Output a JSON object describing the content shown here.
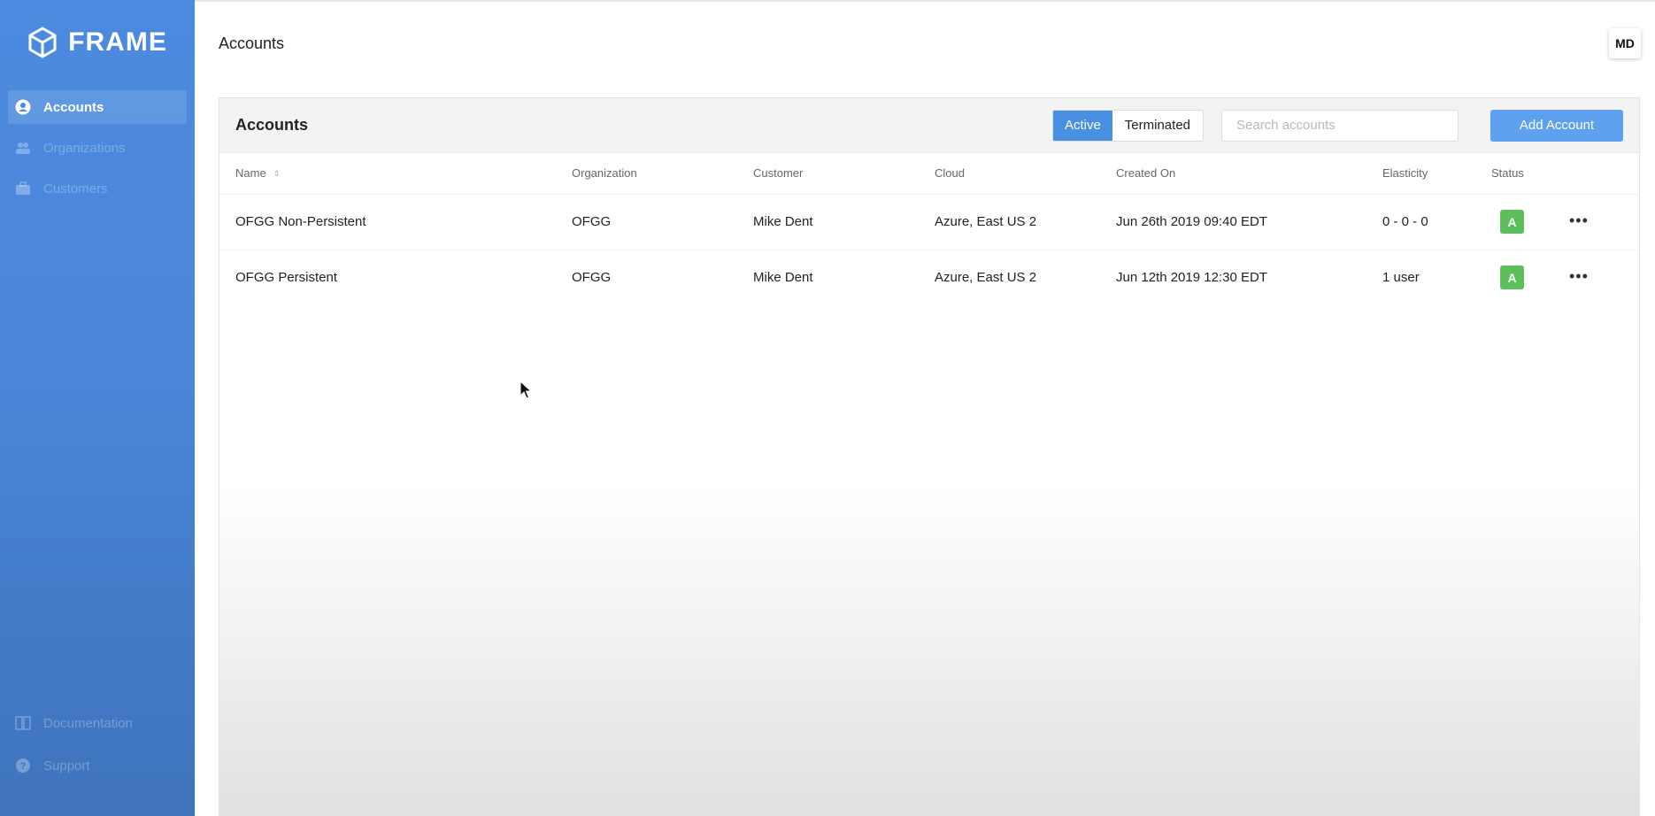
{
  "brand": {
    "name": "FRAME",
    "icon": "cube-icon"
  },
  "sidebar": {
    "items": [
      {
        "label": "Accounts",
        "icon": "user-icon",
        "active": true
      },
      {
        "label": "Organizations",
        "icon": "people-icon",
        "active": false
      },
      {
        "label": "Customers",
        "icon": "briefcase-icon",
        "active": false
      }
    ],
    "bottom": [
      {
        "label": "Documentation",
        "icon": "book-icon"
      },
      {
        "label": "Support",
        "icon": "help-icon"
      }
    ]
  },
  "header": {
    "title": "Accounts",
    "avatar": "MD"
  },
  "panel": {
    "title": "Accounts",
    "filters": {
      "active": "Active",
      "terminated": "Terminated",
      "selected": "Active"
    },
    "search_placeholder": "Search accounts",
    "add_label": "Add Account",
    "columns": [
      "Name",
      "Organization",
      "Customer",
      "Cloud",
      "Created On",
      "Elasticity",
      "Status"
    ],
    "rows": [
      {
        "name": "OFGG Non-Persistent",
        "organization": "OFGG",
        "customer": "Mike Dent",
        "cloud": "Azure, East US 2",
        "created_on": "Jun 26th 2019 09:40 EDT",
        "elasticity": "0 - 0 - 0",
        "status": "A"
      },
      {
        "name": "OFGG Persistent",
        "organization": "OFGG",
        "customer": "Mike Dent",
        "cloud": "Azure, East US 2",
        "created_on": "Jun 12th 2019 12:30 EDT",
        "elasticity": "1 user",
        "status": "A"
      }
    ]
  },
  "colors": {
    "sidebar": "#4a86d8",
    "accent": "#4a90e2",
    "add_button": "#5ea1ee",
    "status_active": "#5cbf5c"
  }
}
